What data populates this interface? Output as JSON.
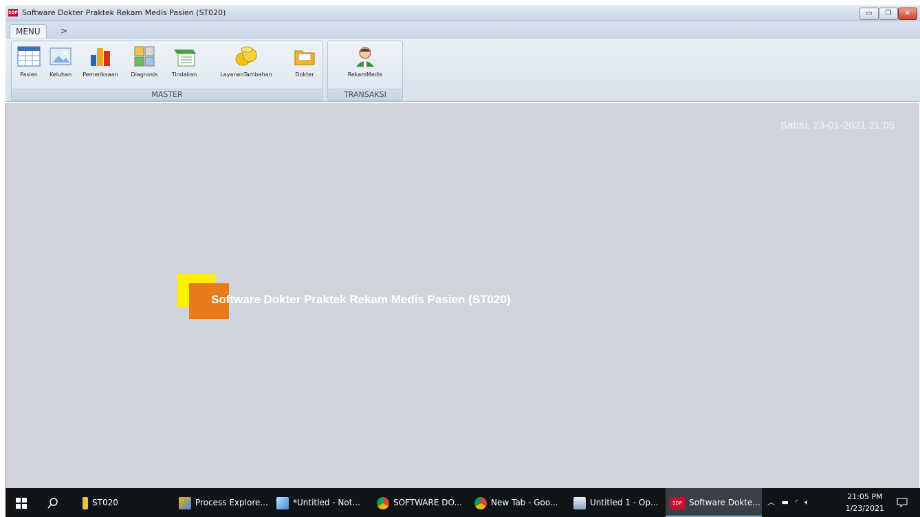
{
  "window": {
    "title": "Software Dokter Praktek Rekam Medis Pasien (ST020)",
    "app_icon": "SDP",
    "controls": [
      "minimize",
      "restore",
      "close"
    ]
  },
  "tabs": [
    {
      "label": "MENU",
      "active": true
    },
    {
      "label": ">",
      "active": false
    }
  ],
  "ribbon": {
    "groups": [
      {
        "label": "MASTER",
        "buttons": [
          {
            "label": "Pasien",
            "icon": "table-icon"
          },
          {
            "label": "Keluhan",
            "icon": "picture-icon"
          },
          {
            "label": "Pemeriksaan",
            "icon": "bar-chart-icon"
          },
          {
            "label": "Diagnosis",
            "icon": "image-grid-icon"
          },
          {
            "label": "Tindakan",
            "icon": "list-icon"
          },
          {
            "label": "LayananTambahan",
            "icon": "coins-icon"
          },
          {
            "label": "Dokter",
            "icon": "folder-icon"
          }
        ]
      },
      {
        "label": "TRANSAKSI",
        "buttons": [
          {
            "label": "RekamMedis",
            "icon": "user-icon"
          }
        ]
      }
    ]
  },
  "main": {
    "datetime": "Sabtu, 23-01-2021 21:05",
    "splash_title": "Software Dokter Praktek Rekam Medis Pasien (ST020)",
    "colors": {
      "yellow": "#ffef00",
      "orange": "#e87a1c",
      "background": "#d0d5dd"
    }
  },
  "taskbar": {
    "items": [
      {
        "label": "ST020",
        "icon": "folder-icon"
      },
      {
        "label": "Process Explore...",
        "icon": "process-explorer-icon"
      },
      {
        "label": "*Untitled - Not...",
        "icon": "notepad-icon"
      },
      {
        "label": "SOFTWARE DO...",
        "icon": "chrome-icon"
      },
      {
        "label": "New Tab - Goo...",
        "icon": "chrome-icon"
      },
      {
        "label": "Untitled 1 - Op...",
        "icon": "openoffice-icon"
      },
      {
        "label": "Software Dokte...",
        "icon": "sdp-icon",
        "active": true
      }
    ],
    "clock_time": "21:05 PM",
    "clock_date": "1/23/2021"
  }
}
